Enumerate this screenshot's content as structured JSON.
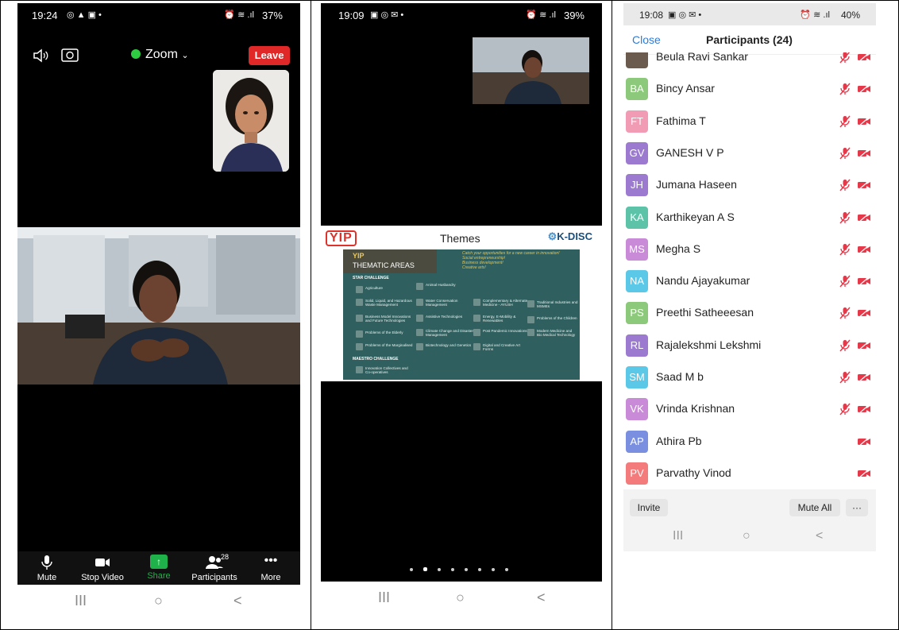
{
  "colors": {
    "accent_green": "#20b24a",
    "leave_red": "#e02828",
    "link_blue": "#2d7bd8",
    "muted_red": "#e5394a"
  },
  "panel1": {
    "status": {
      "time": "19:24",
      "right": "37%"
    },
    "meeting_title": "Zoom",
    "leave_label": "Leave",
    "toolbar": {
      "mute": "Mute",
      "stop_video": "Stop Video",
      "share": "Share",
      "participants": "Participants",
      "participants_count": "28",
      "more": "More"
    }
  },
  "panel2": {
    "status": {
      "time": "19:09",
      "right": "39%"
    },
    "slide": {
      "logo_left": "YIP",
      "title": "Themes",
      "logo_right": "K-DISC",
      "board_title1": "YIP",
      "board_title2": "THEMATIC AREAS",
      "tagline": [
        "Catch your opportunities for a new career in innovation!",
        "Social entrepreneurship!",
        "Business development!",
        "Creative arts!"
      ],
      "star_challenge": "STAR CHALLENGE",
      "maestro_challenge": "MAESTRO CHALLENGE",
      "items": [
        "Agriculture",
        "Animal Husbandry",
        "Solid, Liquid, and Hazardous Waste Management",
        "Water Conservation Management",
        "Complementary & Alternate Medicine - AYUSH",
        "Traditional Industries and MSMEs",
        "Business Model Innovations and Future Technologies",
        "Assistive Technologies",
        "Energy, E-Mobility & Renewables",
        "Problems of the Children",
        "Problems of the Elderly",
        "Climate Change and Disaster Management",
        "Post Pandemic Innovations",
        "Modern Medicine and Bio Medical Technology",
        "Problems of the Marginalised",
        "Biotechnology and Genetics",
        "Digital and Creative Art Forms",
        "Innovation Collectives and Co-operatives"
      ]
    }
  },
  "panel3": {
    "status": {
      "time": "19:08",
      "right": "40%"
    },
    "close_label": "Close",
    "title": "Participants (24)",
    "participants": [
      {
        "initials": "",
        "name": "Beula Ravi Sankar",
        "color": "#6b5a4e",
        "mic_muted": true,
        "video_off": true
      },
      {
        "initials": "BA",
        "name": "Bincy Ansar",
        "color": "#8cc97a",
        "mic_muted": true,
        "video_off": true
      },
      {
        "initials": "FT",
        "name": "Fathima T",
        "color": "#f29bb5",
        "mic_muted": true,
        "video_off": true
      },
      {
        "initials": "GV",
        "name": "GANESH V P",
        "color": "#9b7ad0",
        "mic_muted": true,
        "video_off": true
      },
      {
        "initials": "JH",
        "name": "Jumana Haseen",
        "color": "#9b7ad0",
        "mic_muted": true,
        "video_off": true
      },
      {
        "initials": "KA",
        "name": "Karthikeyan A S",
        "color": "#5cc2a8",
        "mic_muted": true,
        "video_off": true
      },
      {
        "initials": "MS",
        "name": "Megha S",
        "color": "#c98ad8",
        "mic_muted": true,
        "video_off": true
      },
      {
        "initials": "NA",
        "name": "Nandu Ajayakumar",
        "color": "#5bc8e8",
        "mic_muted": true,
        "video_off": true
      },
      {
        "initials": "PS",
        "name": "Preethi Satheeesan",
        "color": "#8cc97a",
        "mic_muted": true,
        "video_off": true
      },
      {
        "initials": "RL",
        "name": "Rajalekshmi Lekshmi",
        "color": "#9b7ad0",
        "mic_muted": true,
        "video_off": true
      },
      {
        "initials": "SM",
        "name": "Saad M b",
        "color": "#5bc8e8",
        "mic_muted": true,
        "video_off": true
      },
      {
        "initials": "VK",
        "name": "Vrinda Krishnan",
        "color": "#c98ad8",
        "mic_muted": true,
        "video_off": true
      },
      {
        "initials": "AP",
        "name": "Athira Pb",
        "color": "#7a8fe0",
        "mic_muted": false,
        "video_off": true
      },
      {
        "initials": "PV",
        "name": "Parvathy Vinod",
        "color": "#f47b7b",
        "mic_muted": false,
        "video_off": true
      }
    ],
    "invite_label": "Invite",
    "mute_all_label": "Mute All",
    "more_label": "···"
  },
  "nav": {
    "recents": "III",
    "home": "○",
    "back": "<"
  }
}
